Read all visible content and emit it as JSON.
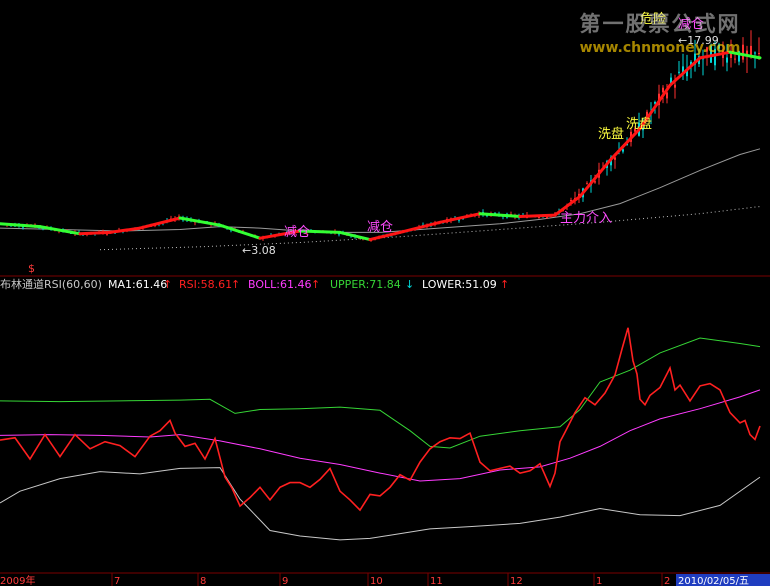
{
  "watermark": {
    "line1": "第一股票公式网",
    "line2": "www.chnmoney.com"
  },
  "upper_panel": {
    "low_label": "←3.08",
    "high_label": "←17.99",
    "annotations": [
      "危险",
      "减仓",
      "洗盘",
      "洗盘",
      "减仓",
      "减仓",
      "主力介入"
    ],
    "divider_marker": "$"
  },
  "indicator_header": {
    "name": "布林通道RSI(60,60)",
    "ma1": "MA1:61.46",
    "rsi": "RSI:58.61",
    "boll": "BOLL:61.46",
    "upper": "UPPER:71.84",
    "lower": "LOWER:51.09",
    "up_arrow": "↑",
    "down_arrow": "↓"
  },
  "x_axis": {
    "labels": [
      "2009年",
      "7",
      "8",
      "9",
      "10",
      "11",
      "12",
      "1",
      "2"
    ],
    "date_box": "2010/02/05/五"
  },
  "colors": {
    "background": "#000000",
    "rsi": "#ff2020",
    "boll": "#ff3cff",
    "upper": "#36d536",
    "lower": "#c8c8c8",
    "header_ma1": "#ffffff",
    "divider": "#7a0000",
    "axis_text": "#ff3b3b",
    "date_box_bg": "#1f3dc0",
    "annotation": "#ffff40",
    "annotation_magenta": "#ff4cff",
    "up_candle": "#ff3030",
    "down_candle": "#00d8d8",
    "trend_up": "#ff1515",
    "trend_down": "#33ff33",
    "ma_gray": "#9a9a9a"
  },
  "chart_data": [
    {
      "type": "candlestick",
      "title": "",
      "price_labels": {
        "low": 3.08,
        "high": 17.99
      },
      "series": [
        {
          "name": "trend",
          "x": [
            0,
            40,
            80,
            110,
            140,
            180,
            220,
            260,
            300,
            340,
            370,
            400,
            440,
            480,
            520,
            555,
            580,
            610,
            640,
            670,
            700,
            730,
            760
          ],
          "values": [
            4.9,
            4.7,
            4.2,
            4.3,
            4.6,
            5.3,
            4.8,
            3.9,
            4.4,
            4.3,
            3.8,
            4.3,
            5.0,
            5.6,
            5.4,
            5.5,
            6.8,
            9.3,
            11.5,
            14.5,
            16.4,
            16.8,
            16.4
          ]
        }
      ]
    },
    {
      "type": "line",
      "title": "",
      "ylim": [
        45,
        80
      ],
      "series": [
        {
          "name": "RSI",
          "x": [
            0,
            15,
            30,
            45,
            60,
            75,
            90,
            105,
            120,
            135,
            150,
            160,
            170,
            175,
            185,
            195,
            205,
            215,
            225,
            232,
            240,
            250,
            260,
            270,
            280,
            290,
            300,
            310,
            320,
            330,
            340,
            350,
            360,
            370,
            380,
            390,
            400,
            410,
            420,
            430,
            440,
            450,
            460,
            470,
            480,
            490,
            500,
            510,
            520,
            530,
            540,
            550,
            555,
            560,
            565,
            575,
            585,
            595,
            605,
            615,
            622,
            628,
            633,
            637,
            640,
            645,
            650,
            660,
            670,
            675,
            680,
            690,
            700,
            710,
            720,
            730,
            740,
            745,
            750,
            755,
            760
          ],
          "values": [
            61.4,
            61.7,
            59.0,
            62.1,
            59.3,
            62.1,
            60.3,
            61.2,
            60.7,
            59.3,
            61.9,
            62.6,
            63.9,
            62.3,
            60.6,
            61.0,
            59.0,
            61.6,
            56.7,
            55.3,
            53.0,
            54.1,
            55.4,
            53.8,
            55.4,
            56.0,
            56.0,
            55.4,
            56.4,
            57.8,
            54.9,
            53.8,
            52.5,
            54.5,
            54.3,
            55.4,
            57.0,
            56.3,
            58.6,
            60.3,
            61.2,
            61.7,
            61.6,
            62.3,
            58.6,
            57.5,
            57.8,
            58.1,
            57.2,
            57.5,
            58.4,
            55.5,
            57.2,
            61.2,
            62.4,
            64.9,
            66.8,
            65.9,
            67.4,
            69.7,
            73.0,
            75.7,
            71.5,
            69.8,
            66.6,
            65.9,
            67.1,
            68.1,
            70.6,
            67.8,
            68.4,
            66.4,
            68.3,
            68.6,
            67.8,
            64.9,
            63.6,
            63.9,
            62.1,
            61.5,
            63.2
          ]
        },
        {
          "name": "BOLL",
          "x": [
            0,
            50,
            100,
            150,
            180,
            220,
            260,
            300,
            340,
            380,
            420,
            460,
            500,
            540,
            570,
            600,
            630,
            660,
            700,
            740,
            760
          ],
          "values": [
            62.0,
            62.1,
            62.0,
            61.8,
            62.1,
            61.3,
            60.3,
            59.1,
            58.3,
            57.2,
            56.2,
            56.5,
            57.6,
            58.0,
            59.1,
            60.6,
            62.6,
            64.1,
            65.4,
            66.9,
            67.8
          ]
        },
        {
          "name": "UPPER",
          "x": [
            0,
            60,
            120,
            180,
            210,
            235,
            260,
            300,
            340,
            380,
            410,
            430,
            450,
            480,
            520,
            560,
            580,
            600,
            630,
            660,
            700,
            740,
            760
          ],
          "values": [
            66.4,
            66.3,
            66.4,
            66.5,
            66.6,
            64.8,
            65.3,
            65.4,
            65.6,
            65.2,
            62.6,
            60.6,
            60.4,
            61.9,
            62.6,
            63.1,
            65.3,
            68.8,
            70.3,
            72.5,
            74.4,
            73.7,
            73.3
          ]
        },
        {
          "name": "LOWER",
          "x": [
            0,
            20,
            60,
            100,
            140,
            180,
            220,
            240,
            270,
            300,
            340,
            370,
            390,
            430,
            470,
            520,
            560,
            600,
            640,
            680,
            720,
            760
          ],
          "values": [
            53.4,
            54.9,
            56.5,
            57.4,
            57.1,
            57.8,
            57.9,
            53.9,
            49.9,
            49.2,
            48.7,
            48.9,
            49.3,
            50.1,
            50.4,
            50.8,
            51.6,
            52.7,
            51.9,
            51.8,
            53.1,
            56.7
          ]
        }
      ]
    }
  ]
}
